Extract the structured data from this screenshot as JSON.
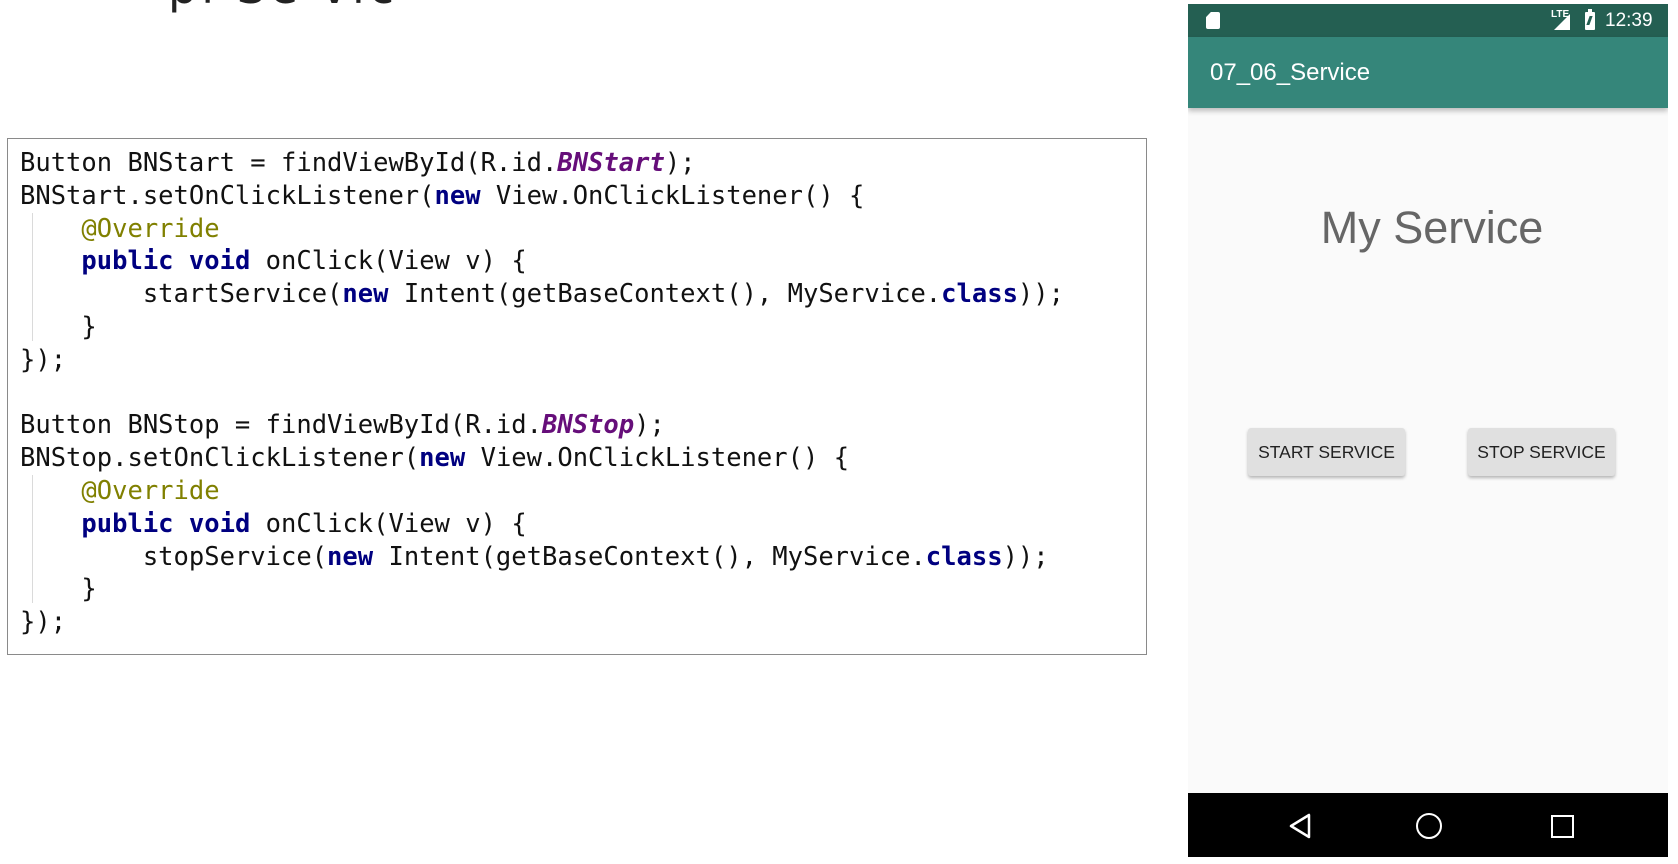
{
  "slide": {
    "title_fragment": "pl Se vic"
  },
  "code": {
    "lines": [
      [
        {
          "t": "Button BNStart = findViewById(R.id."
        },
        {
          "t": "BNStart",
          "c": "fld"
        },
        {
          "t": ");"
        }
      ],
      [
        {
          "t": "BNStart.setOnClickListener("
        },
        {
          "t": "new",
          "c": "kw"
        },
        {
          "t": " View.OnClickListener() {"
        }
      ],
      [
        {
          "t": "    "
        },
        {
          "t": "@Override",
          "c": "ann"
        }
      ],
      [
        {
          "t": "    "
        },
        {
          "t": "public",
          "c": "kw"
        },
        {
          "t": " "
        },
        {
          "t": "void",
          "c": "kw"
        },
        {
          "t": " onClick(View v) {"
        }
      ],
      [
        {
          "t": "        startService("
        },
        {
          "t": "new",
          "c": "kw"
        },
        {
          "t": " Intent(getBaseContext(), MyService."
        },
        {
          "t": "class",
          "c": "kw"
        },
        {
          "t": "));"
        }
      ],
      [
        {
          "t": "    }"
        }
      ],
      [
        {
          "t": "});"
        }
      ],
      [
        {
          "t": ""
        }
      ],
      [
        {
          "t": "Button BNStop = findViewById(R.id."
        },
        {
          "t": "BNStop",
          "c": "fld"
        },
        {
          "t": ");"
        }
      ],
      [
        {
          "t": "BNStop.setOnClickListener("
        },
        {
          "t": "new",
          "c": "kw"
        },
        {
          "t": " View.OnClickListener() {"
        }
      ],
      [
        {
          "t": "    "
        },
        {
          "t": "@Override",
          "c": "ann"
        }
      ],
      [
        {
          "t": "    "
        },
        {
          "t": "public",
          "c": "kw"
        },
        {
          "t": " "
        },
        {
          "t": "void",
          "c": "kw"
        },
        {
          "t": " onClick(View v) {"
        }
      ],
      [
        {
          "t": "        stopService("
        },
        {
          "t": "new",
          "c": "kw"
        },
        {
          "t": " Intent(getBaseContext(), MyService."
        },
        {
          "t": "class",
          "c": "kw"
        },
        {
          "t": "));"
        }
      ],
      [
        {
          "t": "    }"
        }
      ],
      [
        {
          "t": "});"
        }
      ]
    ]
  },
  "phone": {
    "status_bar": {
      "network_label": "LTE",
      "time": "12:39",
      "icons": [
        "sd-card-icon",
        "lte-signal-icon",
        "battery-charging-icon"
      ]
    },
    "app_bar": {
      "title": "07_06_Service"
    },
    "heading": "My Service",
    "buttons": {
      "start_label": "START SERVICE",
      "stop_label": "STOP SERVICE"
    },
    "nav_bar": {
      "icons": [
        "nav-back-icon",
        "nav-home-icon",
        "nav-recents-icon"
      ]
    },
    "colors": {
      "status_bar": "#245f52",
      "app_bar": "#35867a",
      "button": "#e0e0e0",
      "heading_text": "#666666",
      "keyword": "#000080",
      "field": "#660e7a",
      "annotation": "#808000"
    }
  }
}
